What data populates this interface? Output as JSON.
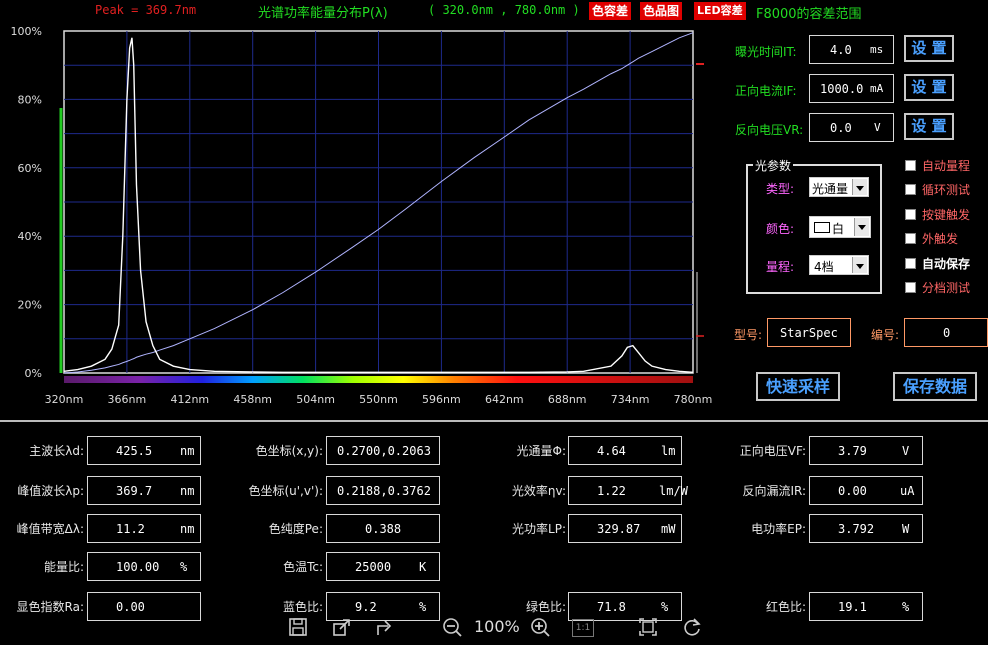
{
  "header": {
    "peak": "Peak = 369.7nm",
    "title": "光谱功率能量分布P(λ)",
    "range": "( 320.0nm , 780.0nm )",
    "tag1": "色容差",
    "tag2": "色品图",
    "tag3": "LED容差",
    "tolerance": "F8000的容差范围"
  },
  "chart_data": {
    "type": "line",
    "x": [
      320,
      330,
      340,
      350,
      355,
      360,
      363,
      366,
      368,
      369.7,
      371,
      373,
      376,
      380,
      385,
      390,
      400,
      412,
      430,
      458,
      480,
      504,
      530,
      550,
      570,
      596,
      620,
      642,
      660,
      688,
      700,
      720,
      728,
      732,
      736,
      740,
      745,
      750,
      760,
      770,
      780
    ],
    "y_spectrum": [
      0.5,
      1,
      2,
      4,
      7,
      14,
      40,
      80,
      95,
      98,
      90,
      55,
      30,
      15,
      8,
      4,
      2,
      1,
      0.5,
      0.3,
      0.2,
      0.2,
      0.2,
      0.2,
      0.2,
      0.2,
      0.2,
      0.2,
      0.2,
      0.3,
      0.5,
      2,
      5,
      7.5,
      8,
      6,
      3.5,
      2,
      1,
      0.5,
      0.2
    ],
    "y_curve": [
      0,
      0.3,
      0.8,
      1.5,
      2,
      2.5,
      3,
      3.4,
      3.7,
      4,
      4.2,
      4.6,
      5,
      5.5,
      6,
      6.7,
      8,
      10,
      13,
      18.5,
      23.5,
      29.5,
      36.5,
      42,
      48,
      56,
      63,
      69,
      74,
      80.5,
      83,
      87.5,
      89,
      90,
      91,
      92,
      93,
      94,
      96,
      98,
      99.5
    ],
    "x_ticks": [
      "320nm",
      "366nm",
      "412nm",
      "458nm",
      "504nm",
      "550nm",
      "596nm",
      "642nm",
      "688nm",
      "734nm",
      "780nm"
    ],
    "y_ticks": [
      "100%",
      "80%",
      "60%",
      "40%",
      "20%",
      "0%"
    ],
    "xlim": [
      320,
      780
    ],
    "ylim": [
      0,
      100
    ]
  },
  "controls": {
    "exposure_label": "曝光时间IT:",
    "exposure_value": "4.0",
    "exposure_unit": "ms",
    "current_label": "正向电流IF:",
    "current_value": "1000.0",
    "current_unit": "mA",
    "voltage_label": "反向电压VR:",
    "voltage_value": "0.0",
    "voltage_unit": "V",
    "set_label": "设 置",
    "group_title": "光参数",
    "type_label": "类型:",
    "type_value": "光通量",
    "color_label": "颜色:",
    "color_value": "白",
    "range_label": "量程:",
    "range_value": "4档",
    "checkboxes": [
      "自动量程",
      "循环测试",
      "按键触发",
      "外触发",
      "自动保存",
      "分档测试"
    ],
    "model_label": "型号:",
    "model_value": "StarSpec",
    "number_label": "编号:",
    "number_value": "0",
    "quick_sample": "快速采样",
    "save_data": "保存数据"
  },
  "results": {
    "dom_wl": {
      "label": "主波长λd:",
      "value": "425.5",
      "unit": "nm"
    },
    "peak_wl": {
      "label": "峰值波长λp:",
      "value": "369.7",
      "unit": "nm"
    },
    "fwhm": {
      "label": "峰值带宽Δλ:",
      "value": "11.2",
      "unit": "nm"
    },
    "energy_ratio": {
      "label": "能量比:",
      "value": "100.00",
      "unit": "%"
    },
    "cri": {
      "label": "显色指数Ra:",
      "value": "0.00",
      "unit": ""
    },
    "xy": {
      "label": "色坐标(x,y):",
      "value": "0.2700,0.2063"
    },
    "uv": {
      "label": "色坐标(u',v'):",
      "value": "0.2188,0.3762"
    },
    "purity": {
      "label": "色纯度Pe:",
      "value": "0.388"
    },
    "cct": {
      "label": "色温Tc:",
      "value": "25000",
      "unit": "K"
    },
    "blue": {
      "label": "蓝色比:",
      "value": "9.2",
      "unit": "%"
    },
    "flux": {
      "label": "光通量Φ:",
      "value": "4.64",
      "unit": "lm"
    },
    "efficacy": {
      "label": "光效率ηv:",
      "value": "1.22",
      "unit": "lm/W"
    },
    "power": {
      "label": "光功率LP:",
      "value": "329.87",
      "unit": "mW"
    },
    "green": {
      "label": "绿色比:",
      "value": "71.8",
      "unit": "%"
    },
    "vf": {
      "label": "正向电压VF:",
      "value": "3.79",
      "unit": "V"
    },
    "ir": {
      "label": "反向漏流IR:",
      "value": "0.00",
      "unit": "uA"
    },
    "ep": {
      "label": "电功率EP:",
      "value": "3.792",
      "unit": "W"
    },
    "red": {
      "label": "红色比:",
      "value": "19.1",
      "unit": "%"
    }
  },
  "toolbar": {
    "zoom": "100%",
    "ratio": "1:1"
  }
}
